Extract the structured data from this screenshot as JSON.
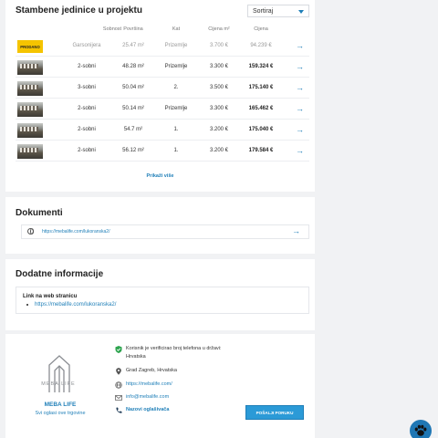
{
  "units": {
    "title": "Stambene jedinice u projektu",
    "sort_label": "Sortiraj",
    "columns": [
      "Sobnost",
      "Površina",
      "Kat",
      "Cijena m²",
      "Cijena"
    ],
    "rows": [
      {
        "badge": "PRODANO",
        "rooms": "Garsonijera",
        "area": "25.47 m²",
        "floor": "Prizemlje",
        "price_m2": "3.700 €",
        "price": "94.239 €",
        "sold": true
      },
      {
        "badge": "",
        "rooms": "2-sobni",
        "area": "48.28 m²",
        "floor": "Prizemlje",
        "price_m2": "3.300 €",
        "price": "159.324 €",
        "sold": false
      },
      {
        "badge": "",
        "rooms": "3-sobni",
        "area": "50.04 m²",
        "floor": "2.",
        "price_m2": "3.500 €",
        "price": "175.140 €",
        "sold": false
      },
      {
        "badge": "",
        "rooms": "2-sobni",
        "area": "50.14 m²",
        "floor": "Prizemlje",
        "price_m2": "3.300 €",
        "price": "165.462 €",
        "sold": false
      },
      {
        "badge": "",
        "rooms": "2-sobni",
        "area": "54.7 m²",
        "floor": "1.",
        "price_m2": "3.200 €",
        "price": "175.040 €",
        "sold": false
      },
      {
        "badge": "",
        "rooms": "2-sobni",
        "area": "56.12 m²",
        "floor": "1.",
        "price_m2": "3.200 €",
        "price": "179.584 €",
        "sold": false
      }
    ],
    "show_more": "Prikaži više"
  },
  "documents": {
    "title": "Dokumenti",
    "link": "https://mebalife.com/lukoranska2/"
  },
  "info": {
    "title": "Dodatne informacije",
    "label": "Link na web stranicu",
    "link": "https://mebalife.com/lukoranska2/"
  },
  "seller": {
    "logo_text": "MEBA LIFE",
    "name": "MEBA LIFE",
    "sub": "Svi oglasi ove trgovine",
    "verified_line1": "Korisnik je verificirao broj telefona u državi:",
    "verified_line2": "Hrvatska",
    "location": "Grad Zagreb, Hrvatska",
    "website": "https://mebalife.com/",
    "email": "info@mebalife.com",
    "call": "Nazovi oglašivača",
    "button": "POŠALJI PORUKU"
  },
  "colors": {
    "accent": "#1f7fb8",
    "badge": "#f5c400",
    "button": "#2b9ad7",
    "verified": "#2ea44f"
  }
}
